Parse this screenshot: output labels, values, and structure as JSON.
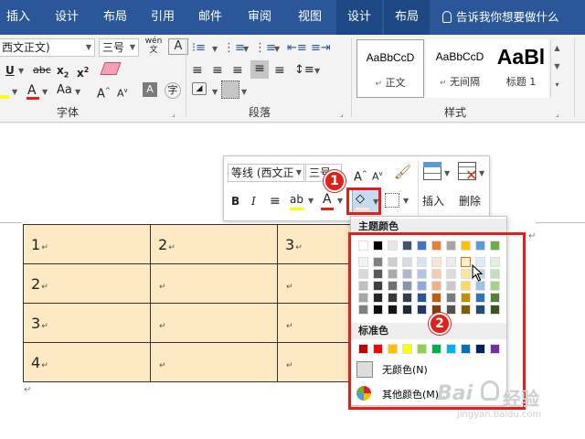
{
  "tabs": [
    "插入",
    "设计",
    "布局",
    "引用",
    "邮件",
    "审阅",
    "视图",
    "设计",
    "布局"
  ],
  "tell_me": "告诉我你想要做什么",
  "ribbon": {
    "font_name": "西文正文)",
    "font_size": "三号",
    "wen_icon": "wén 文",
    "font_group_label": "字体",
    "paragraph_group_label": "段落",
    "styles_group_label": "样式",
    "styles": [
      {
        "preview": "AaBbCcD",
        "name": "正文"
      },
      {
        "preview": "AaBbCcD",
        "name": "无间隔"
      },
      {
        "preview": "AaBl",
        "name": "标题 1"
      }
    ]
  },
  "mini": {
    "font_name": "等线 (西文正",
    "font_size": "三号",
    "insert_label": "插入",
    "delete_label": "删除"
  },
  "palette": {
    "theme_header": "主题颜色",
    "standard_header": "标准色",
    "no_color": "无颜色(N)",
    "more_colors": "其他颜色(M)...",
    "theme_top": [
      "#ffffff",
      "#000000",
      "#e7e6e6",
      "#44546a",
      "#4472c4",
      "#ed7d31",
      "#a5a5a5",
      "#ffc000",
      "#5b9bd5",
      "#70ad47"
    ],
    "theme_cols": [
      [
        "#f2f2f2",
        "#d9d9d9",
        "#bfbfbf",
        "#a6a6a6",
        "#808080"
      ],
      [
        "#808080",
        "#595959",
        "#404040",
        "#262626",
        "#0d0d0d"
      ],
      [
        "#d0cece",
        "#aeaaaa",
        "#757171",
        "#3a3838",
        "#161616"
      ],
      [
        "#d6dce4",
        "#adb9ca",
        "#8496b0",
        "#333f4f",
        "#222a35"
      ],
      [
        "#d9e2f3",
        "#b4c6e7",
        "#8eaadb",
        "#2f5496",
        "#1f3864"
      ],
      [
        "#fbe5d5",
        "#f7cbac",
        "#f4b183",
        "#c55a11",
        "#833c0b"
      ],
      [
        "#ededed",
        "#dbdbdb",
        "#c9c9c9",
        "#7b7b7b",
        "#525252"
      ],
      [
        "#fff2cc",
        "#fee599",
        "#ffd965",
        "#bf9000",
        "#7f6000"
      ],
      [
        "#deebf6",
        "#bdd7ee",
        "#9dc3e6",
        "#2e75b5",
        "#1e4e79"
      ],
      [
        "#e2efd9",
        "#c5e0b3",
        "#a8d08d",
        "#538135",
        "#375623"
      ]
    ],
    "standard": [
      "#c00000",
      "#ff0000",
      "#ffc000",
      "#ffff00",
      "#92d050",
      "#00b050",
      "#00b0f0",
      "#0070c0",
      "#002060",
      "#7030a0"
    ]
  },
  "table": [
    [
      "1",
      "2",
      "3"
    ],
    [
      "2",
      "",
      ""
    ],
    [
      "3",
      "",
      ""
    ],
    [
      "4",
      "",
      ""
    ]
  ],
  "callouts": [
    "1",
    "2"
  ],
  "watermark": {
    "brand": "Bai",
    "text": "经验",
    "url": "jingyan.baidu.com"
  },
  "colors": {
    "ribbon_blue": "#2b579a",
    "cell_fill": "#fde9c3",
    "annotation_red": "#e0211a"
  }
}
